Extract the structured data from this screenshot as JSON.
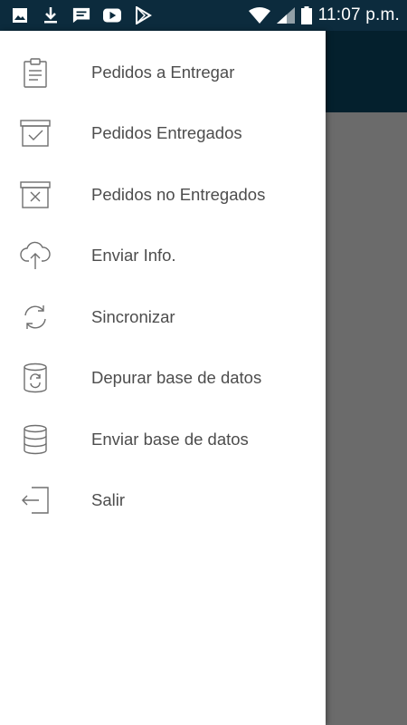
{
  "status_bar": {
    "time": "11:07 p.m.",
    "left_icons": [
      "gallery-icon",
      "download-icon",
      "message-icon",
      "youtube-icon",
      "play-store-icon"
    ],
    "right_icons": [
      "wifi-icon",
      "signal-icon",
      "battery-icon"
    ]
  },
  "drawer": {
    "items": [
      {
        "label": "Pedidos a Entregar",
        "icon": "clipboard-icon"
      },
      {
        "label": "Pedidos Entregados",
        "icon": "box-check-icon"
      },
      {
        "label": "Pedidos no Entregados",
        "icon": "box-x-icon"
      },
      {
        "label": "Enviar Info.",
        "icon": "cloud-upload-icon"
      },
      {
        "label": "Sincronizar",
        "icon": "sync-icon"
      },
      {
        "label": "Depurar base de datos",
        "icon": "database-refresh-icon"
      },
      {
        "label": "Enviar base de datos",
        "icon": "database-icon"
      },
      {
        "label": "Salir",
        "icon": "logout-icon"
      }
    ]
  },
  "colors": {
    "status_bar": "#0c2b3d",
    "app_bar": "#04202d",
    "scrim": "#6b6b6b",
    "drawer_bg": "#ffffff",
    "label_text": "#4d4d4d",
    "icon_stroke": "#6f6f6f"
  }
}
